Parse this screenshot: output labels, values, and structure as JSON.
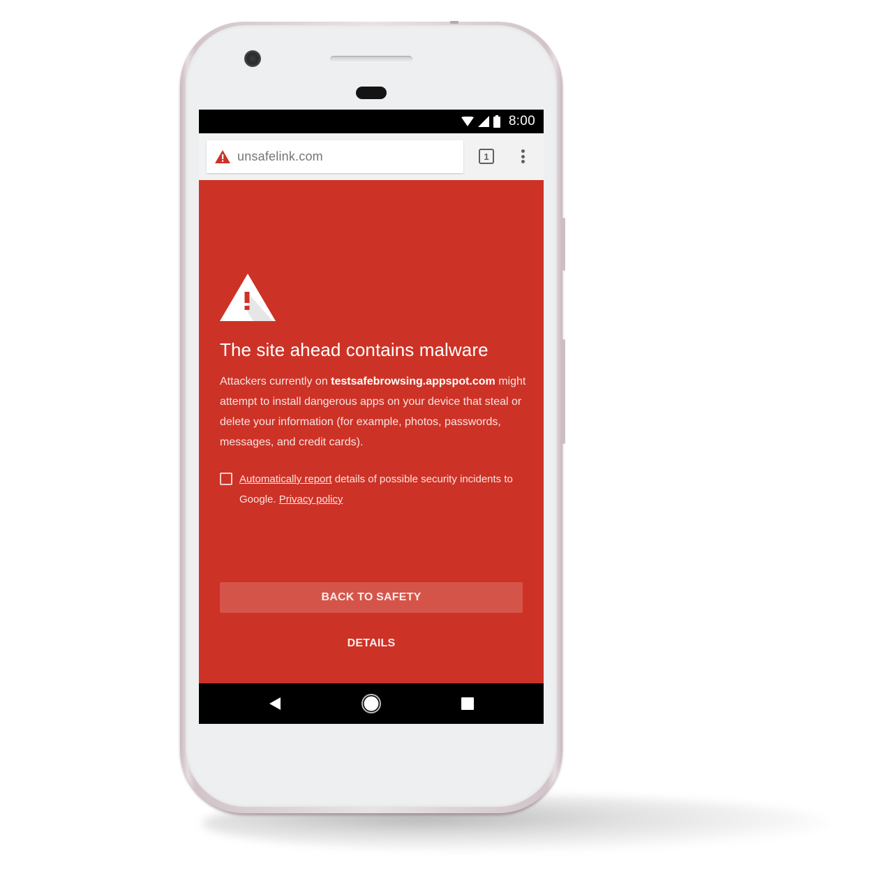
{
  "status_bar": {
    "time": "8:00",
    "icons": [
      "wifi-icon",
      "cell-signal-icon",
      "battery-icon"
    ]
  },
  "toolbar": {
    "url": "unsafelink.com",
    "security_icon": "warning-triangle-icon",
    "tab_count": "1",
    "menu_icon": "more-vert-icon"
  },
  "interstitial": {
    "icon": "warning-triangle-icon",
    "title": "The site ahead contains malware",
    "description": {
      "prefix": "Attackers currently on ",
      "site": "testsafebrowsing.appspot.com",
      "suffix": " might attempt to install dangerous apps on your device that steal or delete your information (for example, photos, passwords, messages, and credit cards)."
    },
    "report": {
      "checked": false,
      "link_text": "Automatically report",
      "text_middle": " details of possible security incidents to Google. ",
      "privacy_link": "Privacy policy"
    },
    "primary_button": "BACK TO SAFETY",
    "secondary_button": "DETAILS"
  },
  "nav_bar": {
    "buttons": [
      "back-icon",
      "home-icon",
      "recents-icon"
    ]
  },
  "colors": {
    "danger_red": "#cd3226",
    "button_red": "#d55449",
    "toolbar_bg": "#f2f2f2",
    "url_text": "#757575"
  }
}
